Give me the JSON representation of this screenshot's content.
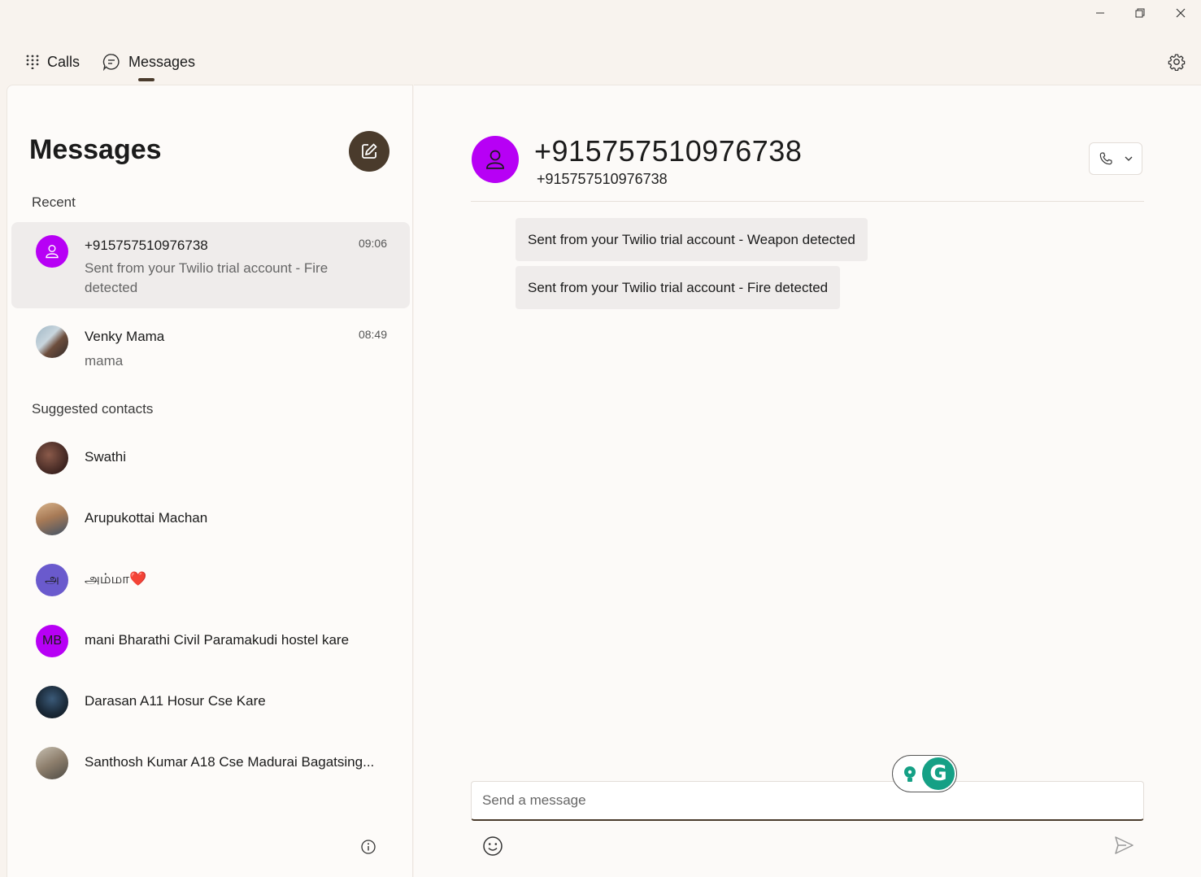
{
  "nav": {
    "calls_label": "Calls",
    "messages_label": "Messages"
  },
  "left": {
    "title": "Messages",
    "recent_label": "Recent",
    "suggested_label": "Suggested contacts",
    "conversations": [
      {
        "name": "+915757510976738",
        "time": "09:06",
        "preview": "Sent from your Twilio trial account - Fire detected",
        "selected": true
      },
      {
        "name": "Venky Mama",
        "time": "08:49",
        "preview": "mama",
        "selected": false
      }
    ],
    "contacts": [
      {
        "name": "Swathi"
      },
      {
        "name": "Arupukottai Machan"
      },
      {
        "name": "அம்மா❤️",
        "initial": "அ"
      },
      {
        "name": "mani Bharathi Civil Paramakudi hostel kare",
        "initial": "MB"
      },
      {
        "name": "Darasan A11 Hosur Cse Kare"
      },
      {
        "name": "Santhosh Kumar A18 Cse Madurai Bagatsing..."
      }
    ]
  },
  "chat": {
    "title": "+915757510976738",
    "subtitle": "+915757510976738",
    "messages": [
      {
        "text": "Sent from your Twilio trial account - Weapon detected"
      },
      {
        "text": "Sent from your Twilio trial account - Fire detected"
      }
    ],
    "input_placeholder": "Send a message"
  },
  "colors": {
    "accent": "#4a3b2c",
    "avatar_purple": "#b700f5",
    "avatar_tamil": "#6a5acd",
    "grammarly": "#15a085"
  }
}
